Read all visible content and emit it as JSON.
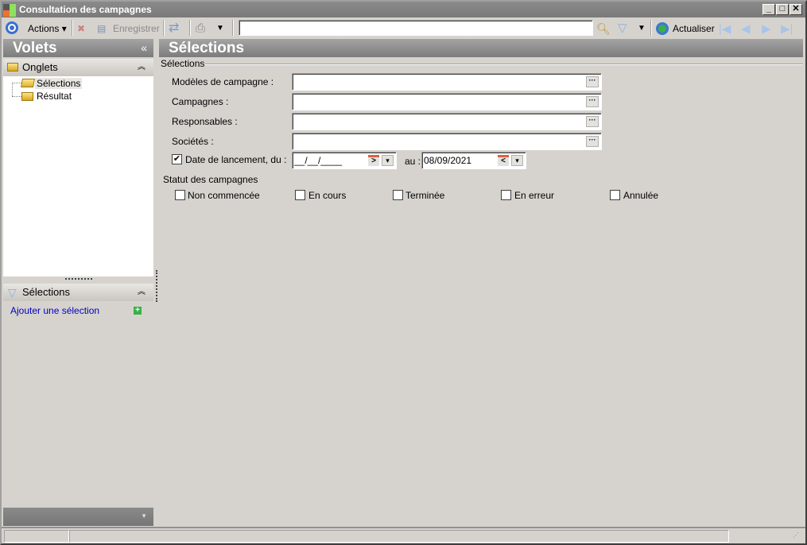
{
  "window": {
    "title": "Consultation des campagnes",
    "controls": [
      "_",
      "□",
      "✕"
    ]
  },
  "toolbar": {
    "actions": "Actions",
    "save": "Enregistrer",
    "search_value": "",
    "refresh": "Actualiser"
  },
  "left": {
    "title": "Volets",
    "collapse": "«",
    "tabs_header": "Onglets",
    "tree": [
      "Sélections",
      "Résultat"
    ],
    "selections_header": "Sélections",
    "add_selection": "Ajouter une sélection",
    "expand": "»"
  },
  "main": {
    "title": "Sélections",
    "group": "Sélections",
    "fields": [
      {
        "label": "Modèles de campagne :",
        "value": ""
      },
      {
        "label": "Campagnes :",
        "value": ""
      },
      {
        "label": "Responsables :",
        "value": ""
      },
      {
        "label": "Sociétés :",
        "value": ""
      }
    ],
    "date": {
      "checked": true,
      "label": "Date de lancement, du :",
      "from": "__/__/____",
      "to_label": "au :",
      "to": "08/09/2021"
    },
    "status_label": "Statut des campagnes",
    "statuses": [
      {
        "label": "Non commencée",
        "checked": false
      },
      {
        "label": "En cours",
        "checked": false
      },
      {
        "label": "Terminée",
        "checked": false
      },
      {
        "label": "En erreur",
        "checked": false
      },
      {
        "label": "Annulée",
        "checked": false
      }
    ]
  }
}
